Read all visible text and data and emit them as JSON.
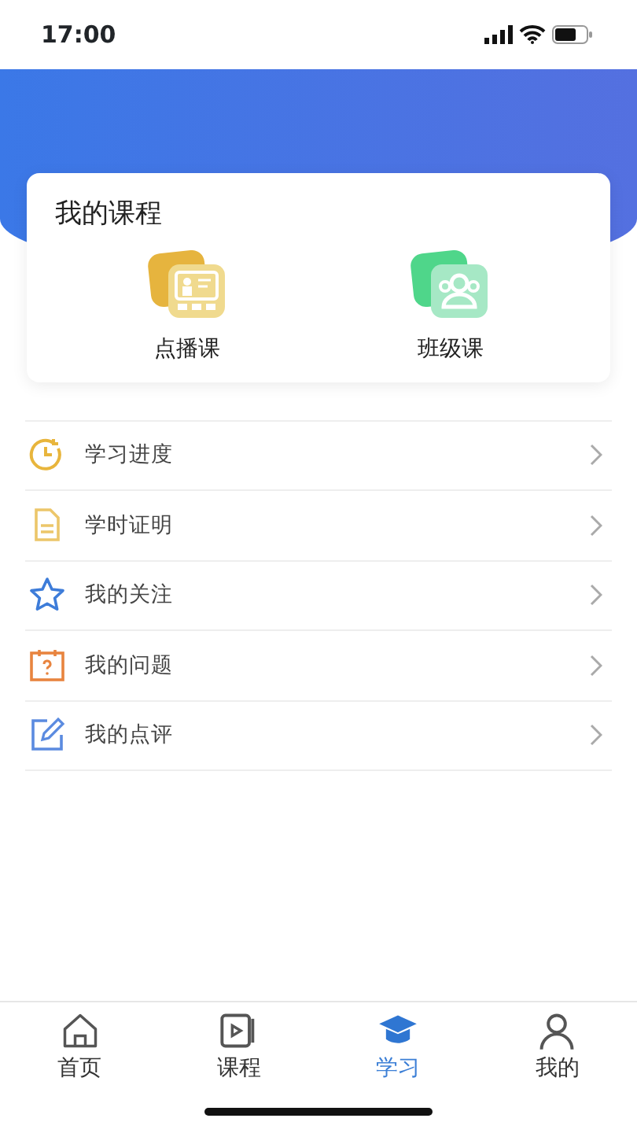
{
  "status_bar": {
    "time": "17:00"
  },
  "courses_card": {
    "title": "我的课程",
    "items": [
      {
        "kind": "vod",
        "label": "点播课"
      },
      {
        "kind": "class",
        "label": "班级课"
      }
    ]
  },
  "menu": [
    {
      "kind": "progress",
      "label": "学习进度"
    },
    {
      "kind": "certificate",
      "label": "学时证明"
    },
    {
      "kind": "follow",
      "label": "我的关注"
    },
    {
      "kind": "question",
      "label": "我的问题"
    },
    {
      "kind": "review",
      "label": "我的点评"
    }
  ],
  "tab_bar": [
    {
      "kind": "home",
      "label": "首页",
      "selected": false
    },
    {
      "kind": "course",
      "label": "课程",
      "selected": false
    },
    {
      "kind": "study",
      "label": "学习",
      "selected": true
    },
    {
      "kind": "me",
      "label": "我的",
      "selected": false
    }
  ]
}
